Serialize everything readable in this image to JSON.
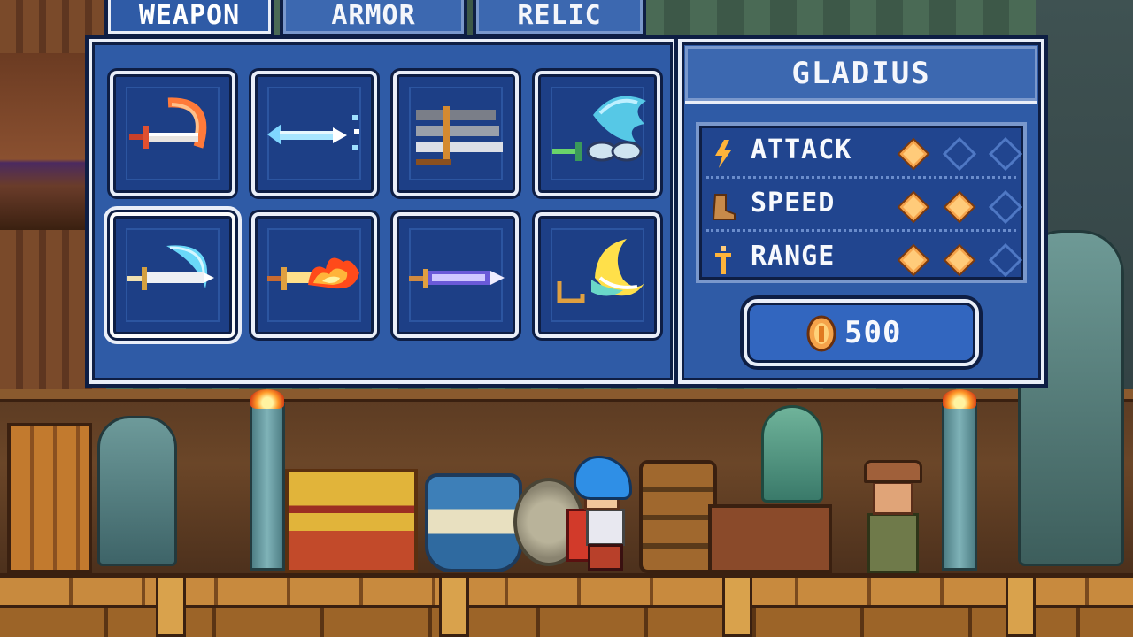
{
  "tabs": [
    {
      "label": "WEAPON",
      "active": true
    },
    {
      "label": "ARMOR",
      "active": false
    },
    {
      "label": "RELIC",
      "active": false
    }
  ],
  "inventory": {
    "items": [
      {
        "icon": "scythe-sword-icon"
      },
      {
        "icon": "ice-spear-icon"
      },
      {
        "icon": "triple-blade-icon"
      },
      {
        "icon": "wing-blade-icon"
      },
      {
        "icon": "crescent-sword-icon",
        "selected": true
      },
      {
        "icon": "flame-sword-icon"
      },
      {
        "icon": "violet-sword-icon"
      },
      {
        "icon": "moon-blade-icon"
      }
    ]
  },
  "detail": {
    "item_name": "GLADIUS",
    "stats": [
      {
        "label": "ATTACK",
        "icon": "lightning-icon",
        "value": 1,
        "max": 3
      },
      {
        "label": "SPEED",
        "icon": "boot-icon",
        "value": 2,
        "max": 3
      },
      {
        "label": "RANGE",
        "icon": "range-icon",
        "value": 2,
        "max": 3
      }
    ],
    "price": "500",
    "price_icon": "coin-icon"
  },
  "colors": {
    "panel": "#2f5ba6",
    "panel_dark": "#1d3f86",
    "border": "#e9eef8",
    "pip_filled": "#f5a34a",
    "pip_empty": "#4f78c4"
  }
}
